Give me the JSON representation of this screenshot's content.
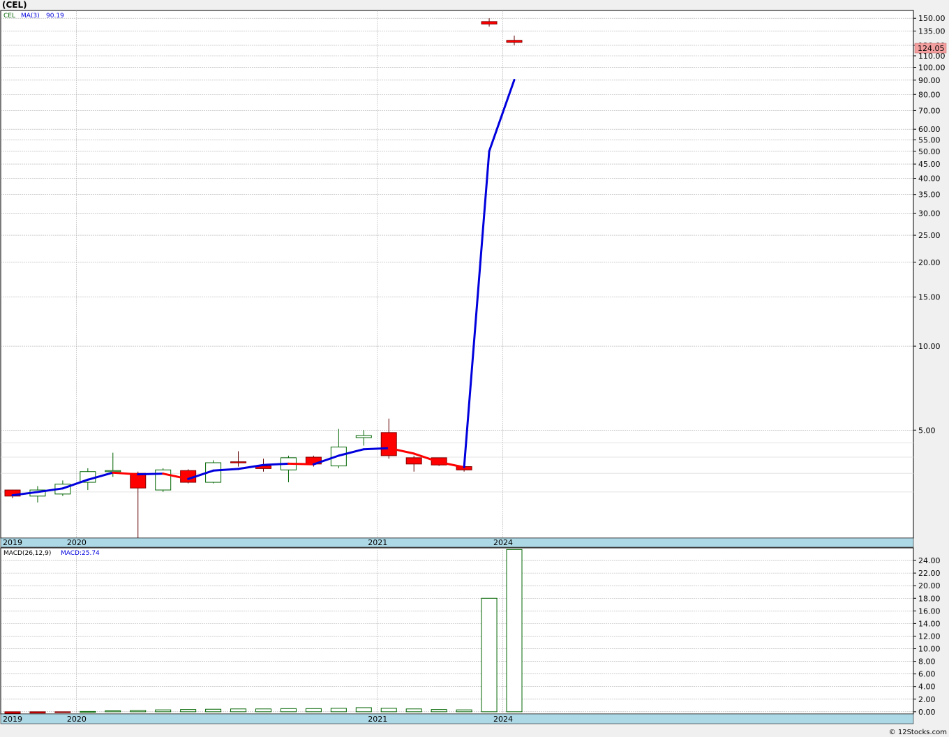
{
  "title": "(CEL)",
  "credit": "© 12Stocks.com",
  "colors": {
    "up": "#006400",
    "down": "#ff0000",
    "ma_up": "#0000dd",
    "ma_down": "#ff0000",
    "axis_band": "#add8e6",
    "last_price_bg": "#f4a0a0",
    "grid": "#b0b0b0"
  },
  "chart_data": [
    {
      "type": "candlestick",
      "scale": "log",
      "legend": {
        "symbol": "CEL",
        "ma_label": "MA(3)",
        "ma_value": "90.19"
      },
      "last_price_label": "124.05",
      "ylim": [
        2.05,
        160
      ],
      "y_tick_labels": [
        "150.00",
        "135.00",
        "120.00",
        "110.00",
        "100.00",
        "90.00",
        "80.00",
        "70.00",
        "60.00",
        "55.00",
        "50.00",
        "45.00",
        "40.00",
        "35.00",
        "30.00",
        "25.00",
        "20.00",
        "15.00",
        "10.00",
        "5.00"
      ],
      "x_year_labels": [
        {
          "label": "2019",
          "index": 0
        },
        {
          "label": "2020",
          "index": 3
        },
        {
          "label": "2021",
          "index": 15
        },
        {
          "label": "2024",
          "index": 20
        }
      ],
      "candles": [
        {
          "o": 3.05,
          "h": 3.05,
          "l": 2.85,
          "c": 2.9
        },
        {
          "o": 2.9,
          "h": 3.15,
          "l": 2.75,
          "c": 3.05
        },
        {
          "o": 2.95,
          "h": 3.3,
          "l": 2.9,
          "c": 3.2
        },
        {
          "o": 3.25,
          "h": 3.65,
          "l": 3.05,
          "c": 3.55
        },
        {
          "o": 3.55,
          "h": 4.15,
          "l": 3.4,
          "c": 3.58
        },
        {
          "o": 3.5,
          "h": 3.55,
          "l": 2.05,
          "c": 3.1
        },
        {
          "o": 3.05,
          "h": 3.65,
          "l": 3.0,
          "c": 3.6
        },
        {
          "o": 3.58,
          "h": 3.62,
          "l": 3.22,
          "c": 3.25
        },
        {
          "o": 3.25,
          "h": 3.9,
          "l": 3.22,
          "c": 3.82
        },
        {
          "o": 3.85,
          "h": 4.2,
          "l": 3.7,
          "c": 3.83
        },
        {
          "o": 3.72,
          "h": 3.95,
          "l": 3.55,
          "c": 3.64
        },
        {
          "o": 3.6,
          "h": 4.05,
          "l": 3.25,
          "c": 3.98
        },
        {
          "o": 4.0,
          "h": 4.05,
          "l": 3.7,
          "c": 3.78
        },
        {
          "o": 3.72,
          "h": 5.05,
          "l": 3.65,
          "c": 4.35
        },
        {
          "o": 4.7,
          "h": 5.0,
          "l": 4.4,
          "c": 4.78
        },
        {
          "o": 4.9,
          "h": 5.5,
          "l": 3.95,
          "c": 4.05
        },
        {
          "o": 3.98,
          "h": 4.05,
          "l": 3.55,
          "c": 3.78
        },
        {
          "o": 3.98,
          "h": 3.98,
          "l": 3.72,
          "c": 3.75
        },
        {
          "o": 3.7,
          "h": 3.74,
          "l": 3.55,
          "c": 3.6
        },
        {
          "o": 146,
          "h": 150,
          "l": 140,
          "c": 143
        },
        {
          "o": 125,
          "h": 130,
          "l": 120,
          "c": 123
        }
      ],
      "ma": [
        {
          "i": 0,
          "v": 2.92
        },
        {
          "i": 1,
          "v": 3.0
        },
        {
          "i": 2,
          "v": 3.09
        },
        {
          "i": 3,
          "v": 3.32
        },
        {
          "i": 4,
          "v": 3.52
        },
        {
          "i": 5,
          "v": 3.47
        },
        {
          "i": 6,
          "v": 3.49
        },
        {
          "i": 7,
          "v": 3.34
        },
        {
          "i": 8,
          "v": 3.58
        },
        {
          "i": 9,
          "v": 3.63
        },
        {
          "i": 10,
          "v": 3.75
        },
        {
          "i": 11,
          "v": 3.79
        },
        {
          "i": 12,
          "v": 3.77
        },
        {
          "i": 13,
          "v": 4.05
        },
        {
          "i": 14,
          "v": 4.27
        },
        {
          "i": 15,
          "v": 4.31
        },
        {
          "i": 16,
          "v": 4.12
        },
        {
          "i": 17,
          "v": 3.84
        },
        {
          "i": 18,
          "v": 3.68
        },
        {
          "i": 19,
          "v": 50.0
        },
        {
          "i": 20,
          "v": 90.19
        }
      ]
    },
    {
      "type": "bar",
      "legend": {
        "label": "MACD(26,12,9)",
        "value_label": "MACD:25.74"
      },
      "ylim": [
        -0.35,
        26.0
      ],
      "y_tick_labels": [
        "24.00",
        "22.00",
        "20.00",
        "18.00",
        "16.00",
        "14.00",
        "12.00",
        "10.00",
        "8.00",
        "6.00",
        "4.00",
        "2.00",
        "0.00"
      ],
      "x_year_labels": [
        {
          "label": "2019",
          "index": 0
        },
        {
          "label": "2020",
          "index": 3
        },
        {
          "label": "2021",
          "index": 15
        },
        {
          "label": "2024",
          "index": 20
        }
      ],
      "values": [
        -0.25,
        -0.2,
        -0.1,
        0.05,
        0.15,
        0.2,
        0.3,
        0.35,
        0.4,
        0.45,
        0.45,
        0.5,
        0.5,
        0.55,
        0.65,
        0.55,
        0.45,
        0.35,
        0.3,
        18.0,
        25.74
      ]
    }
  ]
}
